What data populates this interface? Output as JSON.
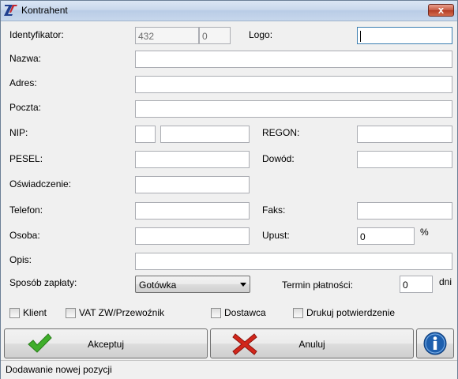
{
  "window": {
    "title": "Kontrahent",
    "close_symbol": "x"
  },
  "labels": {
    "identyfikator": "Identyfikator:",
    "logo": "Logo:",
    "nazwa": "Nazwa:",
    "adres": "Adres:",
    "poczta": "Poczta:",
    "nip": "NIP:",
    "regon": "REGON:",
    "pesel": "PESEL:",
    "dowod": "Dowód:",
    "oswiadczenie": "Oświadczenie:",
    "telefon": "Telefon:",
    "faks": "Faks:",
    "osoba": "Osoba:",
    "upust": "Upust:",
    "upust_unit": "%",
    "opis": "Opis:",
    "sposob_zaplaty": "Sposób zapłaty:",
    "termin_platnosci": "Termin płatności:",
    "termin_unit": "dni"
  },
  "fields": {
    "identyfikator_id": "432",
    "identyfikator_sub": "0",
    "upust": "0",
    "termin": "0",
    "sposob_zaplaty": "Gotówka"
  },
  "checkboxes": {
    "klient": {
      "label": "Klient",
      "checked": false
    },
    "vat": {
      "label": "VAT ZW/Przewoźnik",
      "checked": false
    },
    "dostawca": {
      "label": "Dostawca",
      "checked": false
    },
    "drukuj": {
      "label": "Drukuj potwierdzenie",
      "checked": false
    }
  },
  "buttons": {
    "accept": "Akceptuj",
    "cancel": "Anuluj"
  },
  "icons": {
    "accept": "checkmark-icon",
    "cancel": "red-x-icon",
    "info": "info-icon",
    "app": "app-logo-icon"
  },
  "colors": {
    "accept_icon": "#3fae2a",
    "cancel_icon": "#d2261b",
    "info_icon": "#1d5fae"
  },
  "status": "Dodawanie nowej pozycji"
}
